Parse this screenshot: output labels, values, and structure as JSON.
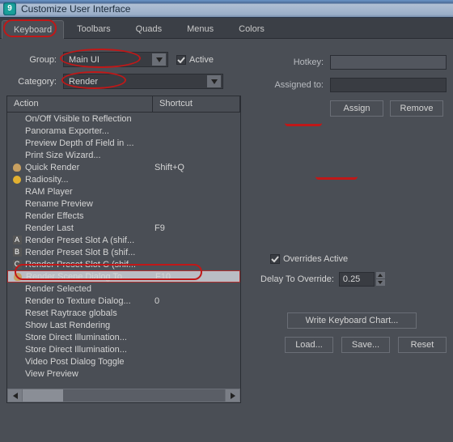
{
  "title": "Customize User Interface",
  "tabs": [
    "Keyboard",
    "Toolbars",
    "Quads",
    "Menus",
    "Colors"
  ],
  "active_tab": 0,
  "group_label": "Group:",
  "group_value": "Main UI",
  "active_label": "Active",
  "active_checked": true,
  "category_label": "Category:",
  "category_value": "Render",
  "columns": {
    "action": "Action",
    "shortcut": "Shortcut"
  },
  "items": [
    {
      "label": "On/Off Visible to Reflection",
      "shortcut": "",
      "icon": ""
    },
    {
      "label": "Panorama Exporter...",
      "shortcut": "",
      "icon": ""
    },
    {
      "label": "Preview Depth of Field in ...",
      "shortcut": "",
      "icon": ""
    },
    {
      "label": "Print Size Wizard...",
      "shortcut": "",
      "icon": ""
    },
    {
      "label": "Quick Render",
      "shortcut": "Shift+Q",
      "icon": "tea"
    },
    {
      "label": "Radiosity...",
      "shortcut": "",
      "icon": "sun"
    },
    {
      "label": "RAM Player",
      "shortcut": "",
      "icon": ""
    },
    {
      "label": "Rename Preview",
      "shortcut": "",
      "icon": ""
    },
    {
      "label": "Render Effects",
      "shortcut": "",
      "icon": ""
    },
    {
      "label": "Render Last",
      "shortcut": "F9",
      "icon": ""
    },
    {
      "label": "Render Preset Slot A (shif...",
      "shortcut": "",
      "icon": "A"
    },
    {
      "label": "Render Preset Slot B (shif...",
      "shortcut": "",
      "icon": "B"
    },
    {
      "label": "Render Preset Slot C (shif...",
      "shortcut": "",
      "icon": "C"
    },
    {
      "label": "Render Scene Dialog To...",
      "shortcut": "F10",
      "icon": "tea",
      "selected": true
    },
    {
      "label": "Render Selected",
      "shortcut": "",
      "icon": ""
    },
    {
      "label": "Render to Texture Dialog...",
      "shortcut": "0",
      "icon": ""
    },
    {
      "label": "Reset Raytrace globals",
      "shortcut": "",
      "icon": ""
    },
    {
      "label": "Show Last Rendering",
      "shortcut": "",
      "icon": ""
    },
    {
      "label": "Store Direct Illumination...",
      "shortcut": "",
      "icon": ""
    },
    {
      "label": "Store Direct Illumination...",
      "shortcut": "",
      "icon": ""
    },
    {
      "label": "Video Post Dialog Toggle",
      "shortcut": "",
      "icon": ""
    },
    {
      "label": "View Preview",
      "shortcut": "",
      "icon": ""
    }
  ],
  "hotkey_label": "Hotkey:",
  "hotkey_value": "",
  "assigned_label": "Assigned to:",
  "assigned_value": "",
  "assign_btn": "Assign",
  "remove_btn": "Remove",
  "overrides_label": "Overrides Active",
  "overrides_checked": true,
  "delay_label": "Delay To Override:",
  "delay_value": "0.25",
  "write_chart_btn": "Write Keyboard Chart...",
  "load_btn": "Load...",
  "save_btn": "Save...",
  "reset_btn": "Reset"
}
